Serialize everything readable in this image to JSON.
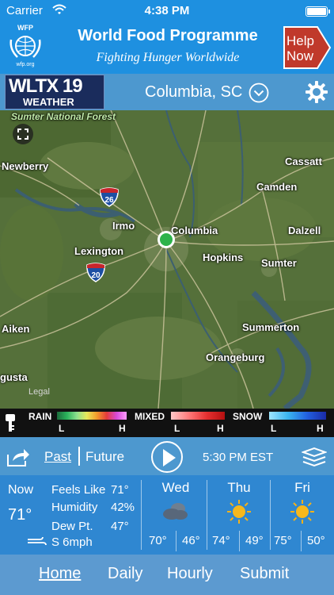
{
  "status_bar": {
    "carrier": "Carrier",
    "time": "4:38 PM"
  },
  "ad": {
    "logo_top": "WFP",
    "logo_bottom": "wfp.org",
    "title": "World Food Programme",
    "subtitle": "Fighting Hunger Worldwide",
    "button_label": "Help Now",
    "accent_color": "#c0392b"
  },
  "header": {
    "station_name": "WLTX 19",
    "station_sub": "WEATHER",
    "location": "Columbia, SC"
  },
  "map": {
    "labels": {
      "forest": "Sumter National Forest",
      "newberry": "Newberry",
      "cassatt": "Cassatt",
      "camden": "Camden",
      "irmo": "Irmo",
      "columbia": "Columbia",
      "dalzell": "Dalzell",
      "lexington": "Lexington",
      "hopkins": "Hopkins",
      "sumter": "Sumter",
      "summerton": "Summerton",
      "aiken": "Aiken",
      "orangeburg": "Orangeburg",
      "augusta": "gusta",
      "legal": "Legal"
    },
    "interstates": {
      "i26": "26",
      "i20": "20",
      "i26_south": "26"
    }
  },
  "legend": {
    "rain": {
      "title": "RAIN",
      "low": "L",
      "high": "H"
    },
    "mixed": {
      "title": "MIXED",
      "low": "L",
      "high": "H"
    },
    "snow": {
      "title": "SNOW",
      "low": "L",
      "high": "H"
    }
  },
  "timeline": {
    "past": "Past",
    "future": "Future",
    "time": "5:30 PM EST"
  },
  "current": {
    "now_label": "Now",
    "temperature": "71°",
    "feels_like_label": "Feels Like",
    "feels_like": "71°",
    "humidity_label": "Humidity",
    "humidity": "42%",
    "dew_point_label": "Dew Pt.",
    "dew_point": "47°",
    "wind": "S 6mph"
  },
  "forecast": [
    {
      "day": "Wed",
      "icon": "partly-cloudy-icon",
      "high": "70°",
      "low": "46°"
    },
    {
      "day": "Thu",
      "icon": "sun-icon",
      "high": "74°",
      "low": "49°"
    },
    {
      "day": "Fri",
      "icon": "sun-icon",
      "high": "75°",
      "low": "50°"
    }
  ],
  "nav": {
    "home": "Home",
    "daily": "Daily",
    "hourly": "Hourly",
    "submit": "Submit"
  }
}
